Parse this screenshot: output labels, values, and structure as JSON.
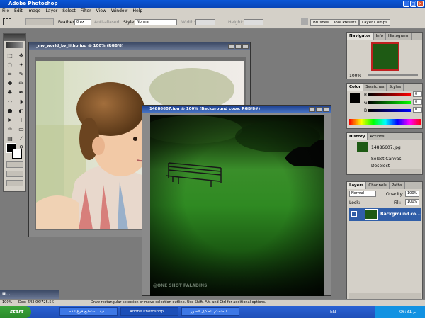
{
  "app": {
    "title": "Adobe Photoshop"
  },
  "menu": [
    "File",
    "Edit",
    "Image",
    "Layer",
    "Select",
    "Filter",
    "View",
    "Window",
    "Help"
  ],
  "options": {
    "feather_label": "Feather:",
    "feather_value": "0 px",
    "antialiased": "Anti-aliased",
    "style_label": "Style:",
    "style_value": "Normal",
    "width_label": "Width:",
    "height_label": "Height:"
  },
  "palette_tabs": [
    "Brushes",
    "Tool Presets",
    "Layer Comps"
  ],
  "doc1": {
    "title": "_my_world_by_lithp.jpg @ 100% (RGB/8)"
  },
  "doc2": {
    "title": "14886607.jpg @ 100% (Background copy, RGB/8#)",
    "watermark": "@ONE SHOT PALADINS"
  },
  "navigator": {
    "tabs": [
      "Navigator",
      "Info",
      "Histogram"
    ],
    "zoom": "100%"
  },
  "color": {
    "tabs": [
      "Color",
      "Swatches",
      "Styles"
    ],
    "r": "0",
    "g": "0",
    "b": "0",
    "r_label": "R",
    "g_label": "G",
    "b_label": "B"
  },
  "history": {
    "tabs": [
      "History",
      "Actions"
    ],
    "items": [
      "14886607.jpg",
      "Select Canvas",
      "Deselect"
    ]
  },
  "layers": {
    "tabs": [
      "Layers",
      "Channels",
      "Paths"
    ],
    "blend": "Normal",
    "opacity_label": "Opacity:",
    "opacity": "100%",
    "lock_label": "Lock:",
    "fill_label": "Fill:",
    "fill": "100%",
    "layer_name": "Background co..."
  },
  "status": {
    "zoom": "100%",
    "doc": "Doc: 643.0K/725.5K",
    "hint": "Draw rectangular selection or move selection outline. Use Shift, Alt, and Ctrl for additional options."
  },
  "taskbar": {
    "start": "start",
    "tasks": [
      "كيف استطيع فرغ القم...",
      "Adobe Photoshop",
      "المتحكم لتحكيل الصور..."
    ],
    "lang": "EN",
    "clock": "06:31 م"
  },
  "minimized": {
    "label": "U..."
  }
}
